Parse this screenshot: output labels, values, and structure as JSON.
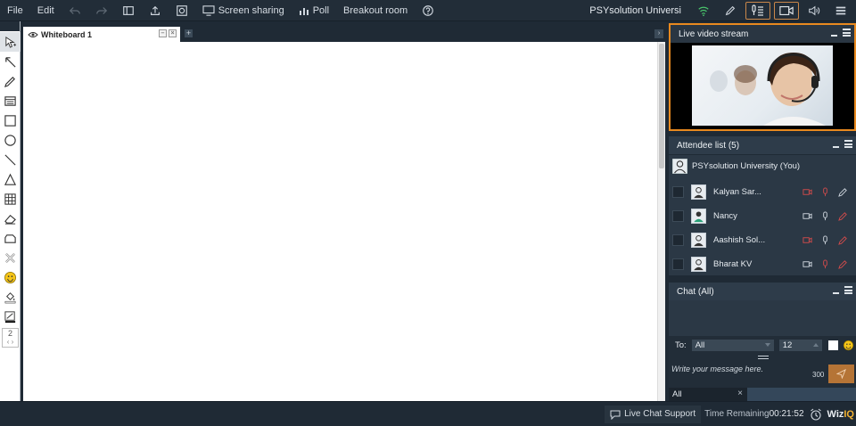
{
  "menu": {
    "file": "File",
    "edit": "Edit"
  },
  "toolbar": {
    "screen_sharing": "Screen sharing",
    "poll": "Poll",
    "breakout_room": "Breakout room",
    "institution": "PSYsolution Universi"
  },
  "whiteboard": {
    "tab_label": "Whiteboard 1"
  },
  "tools": {
    "page_number": "2"
  },
  "video": {
    "title": "Live video stream"
  },
  "attendees": {
    "title": "Attendee list (5)",
    "owner": "PSYsolution University (You)",
    "rows": [
      {
        "name": "Kalyan Sar..."
      },
      {
        "name": "Nancy"
      },
      {
        "name": "Aashish Sol..."
      },
      {
        "name": "Bharat KV"
      }
    ]
  },
  "chat": {
    "title": "Chat (All)",
    "to_label": "To:",
    "to_value": "All",
    "font_size": "12",
    "placeholder": "Write your message here.",
    "char_count": "300",
    "tab_all": "All",
    "tab_close": "×"
  },
  "footer": {
    "live_chat_support": "Live Chat Support",
    "time_remaining_label": "Time Remaining",
    "time_remaining_value": "00:21:52",
    "brand_wiz": "Wiz",
    "brand_iq": "IQ"
  },
  "colors": {
    "accent_orange": "#e8891f",
    "panel_header": "#2e3c4a",
    "panel_body": "#2b3845",
    "send_button": "#b57436"
  },
  "icons": [
    "undo-icon",
    "redo-icon",
    "layout-icon",
    "upload-icon",
    "record-icon",
    "screen-share-icon",
    "poll-icon",
    "help-icon",
    "wifi-icon",
    "pen-icon",
    "mic-list-icon",
    "camera-icon",
    "speaker-icon",
    "hamburger-icon"
  ]
}
